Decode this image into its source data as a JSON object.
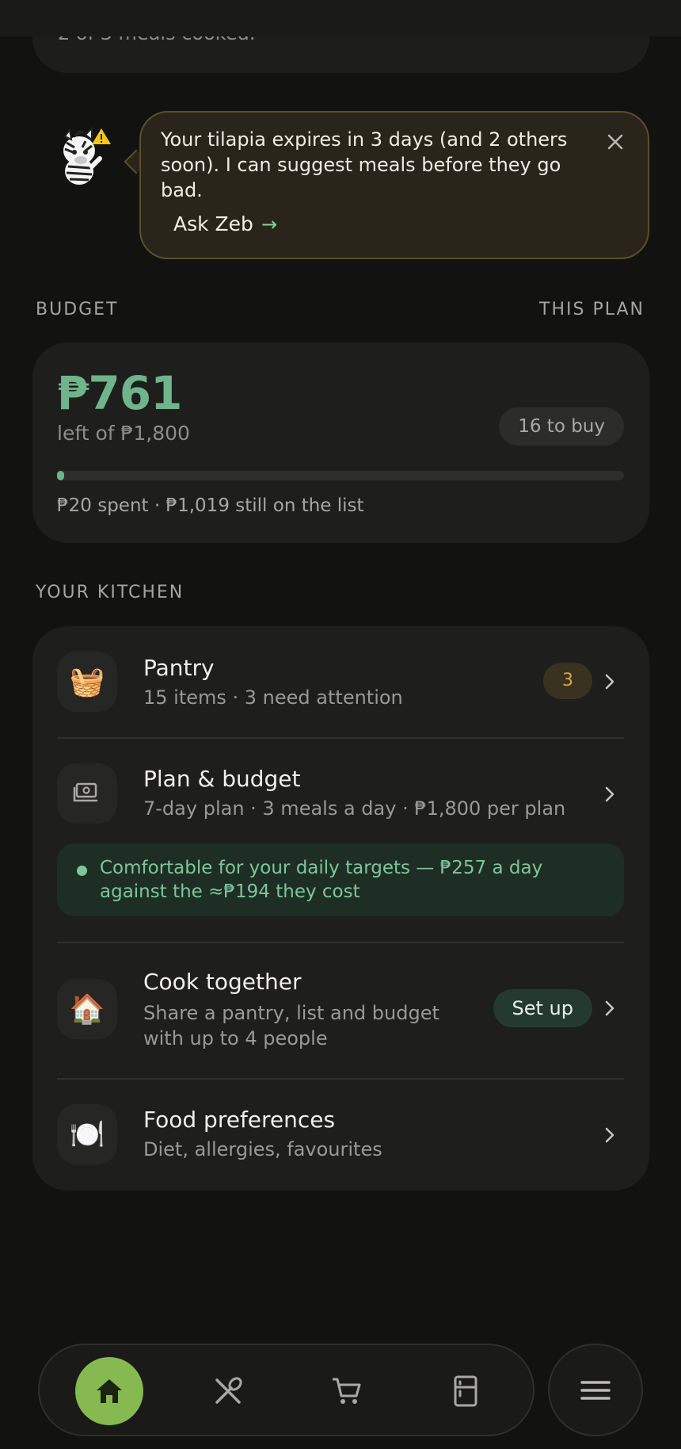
{
  "previous_card": {
    "text": "2 of 3 meals cooked."
  },
  "nudge": {
    "message": "Your tilapia expires in 3 days (and 2 others soon). I can suggest meals before they go bad.",
    "action_label": "Ask Zeb",
    "arrow": "→",
    "avatar_icon": "zebra-mascot-icon",
    "close_icon": "close-icon"
  },
  "budget": {
    "section_label": "BUDGET",
    "scope_label": "THIS PLAN",
    "remaining": "₱761",
    "left_of": "left of ₱1,800",
    "to_buy": "16 to buy",
    "progress_fraction": 0.011,
    "footer": "₱20 spent · ₱1,019 still on the list",
    "accent_color": "#6fb48c"
  },
  "kitchen": {
    "section_label": "YOUR KITCHEN",
    "pantry": {
      "icon": "🧺",
      "title": "Pantry",
      "subtitle": "15 items · 3 need attention",
      "badge": "3"
    },
    "plan": {
      "icon_name": "money-icon",
      "title": "Plan & budget",
      "subtitle": "7-day plan · 3 meals a day · ₱1,800 per plan"
    },
    "plan_note": "Comfortable for your daily targets — ₱257 a day against the ≈₱194 they cost",
    "cook_together": {
      "icon": "🏠",
      "title": "Cook together",
      "subtitle": "Share a pantry, list and budget with up to 4 people",
      "action": "Set up"
    },
    "food_prefs": {
      "icon": "🍽️",
      "title": "Food preferences",
      "subtitle": "Diet, allergies, favourites"
    }
  },
  "nav": {
    "items": [
      "home-icon",
      "utensils-icon",
      "cart-icon",
      "fridge-icon"
    ],
    "active": "home-icon",
    "menu": "menu-icon",
    "active_color": "#86b94f"
  }
}
